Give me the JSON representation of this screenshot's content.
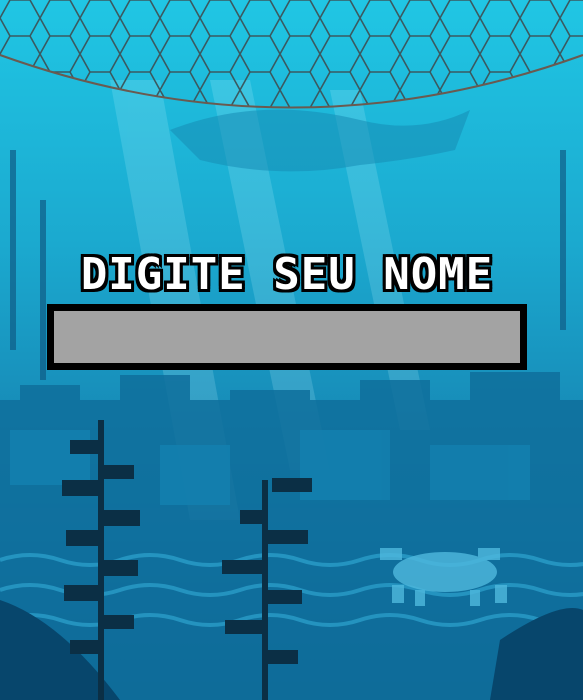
{
  "screen": {
    "prompt_label": "DIGITE SEU NOME",
    "name_input_value": ""
  },
  "scene": {
    "net": "fishing-net-icon",
    "creature": "crab-icon",
    "plants": "seaweed-icon"
  },
  "colors": {
    "water_top": "#1cc3e2",
    "water_bottom": "#0a5f86",
    "input_fill": "#a3a3a3",
    "text": "#ffffff",
    "outline": "#000000"
  }
}
